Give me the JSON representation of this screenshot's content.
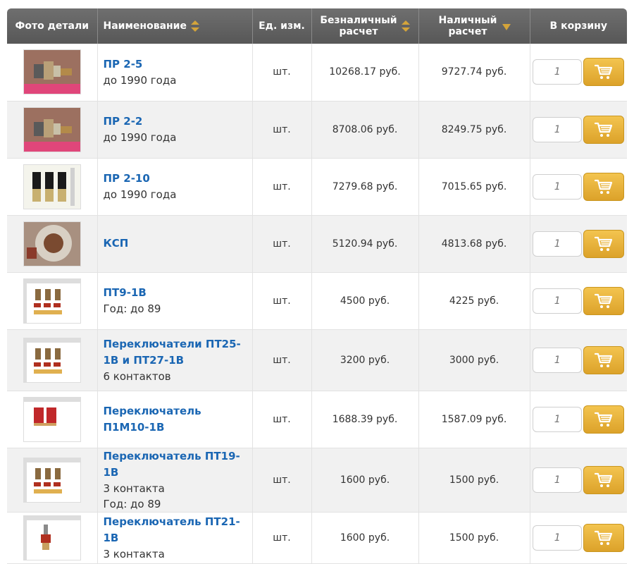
{
  "header": {
    "photo": "Фото детали",
    "name": "Наименование",
    "unit": "Ед. изм.",
    "cashless": "Безналичный расчет",
    "cash": "Наличный расчет",
    "cart": "В корзину"
  },
  "accent": "#d4a43a",
  "link_color": "#1a66b3",
  "rows": [
    {
      "name": "ПР 2-5",
      "lines": [
        "до 1990 года"
      ],
      "unit": "шт.",
      "cashless": "10268.17 руб.",
      "cash": "9727.74 руб.",
      "qty": "1",
      "photo": "rotary-part"
    },
    {
      "name": "ПР 2-2",
      "lines": [
        "до 1990 года"
      ],
      "unit": "шт.",
      "cashless": "8708.06 руб.",
      "cash": "8249.75 руб.",
      "qty": "1",
      "photo": "rotary-part"
    },
    {
      "name": "ПР 2-10",
      "lines": [
        "до 1990 года"
      ],
      "unit": "шт.",
      "cashless": "7279.68 руб.",
      "cash": "7015.65 руб.",
      "qty": "1",
      "photo": "three-switches"
    },
    {
      "name": "КСП",
      "lines": [],
      "unit": "шт.",
      "cashless": "5120.94 руб.",
      "cash": "4813.68 руб.",
      "qty": "1",
      "photo": "round-switch"
    },
    {
      "name": "ПТ9-1В",
      "lines": [
        " Год: до 89"
      ],
      "unit": "шт.",
      "cashless": "4500 руб.",
      "cash": "4225 руб.",
      "qty": "1",
      "photo": "toggle-set"
    },
    {
      "name": "Переключатели ПТ25-1В и ПТ27-1В",
      "lines": [
        "6 контактов"
      ],
      "unit": "шт.",
      "cashless": "3200 руб.",
      "cash": "3000 руб.",
      "qty": "1",
      "photo": "toggle-set"
    },
    {
      "name": "Переключатель П1М10-1В",
      "lines": [],
      "unit": "шт.",
      "cashless": "1688.39 руб.",
      "cash": "1587.09 руб.",
      "qty": "1",
      "photo": "red-blocks"
    },
    {
      "name": "Переключатель ПТ19-1В",
      "lines": [
        "3 контакта",
        "Год: до 89"
      ],
      "unit": "шт.",
      "cashless": "1600 руб.",
      "cash": "1500 руб.",
      "qty": "1",
      "photo": "toggle-set"
    },
    {
      "name": "Переключатель ПТ21-1В",
      "lines": [
        "3 контакта"
      ],
      "unit": "шт.",
      "cashless": "1600 руб.",
      "cash": "1500 руб.",
      "qty": "1",
      "photo": "single-toggle"
    }
  ]
}
